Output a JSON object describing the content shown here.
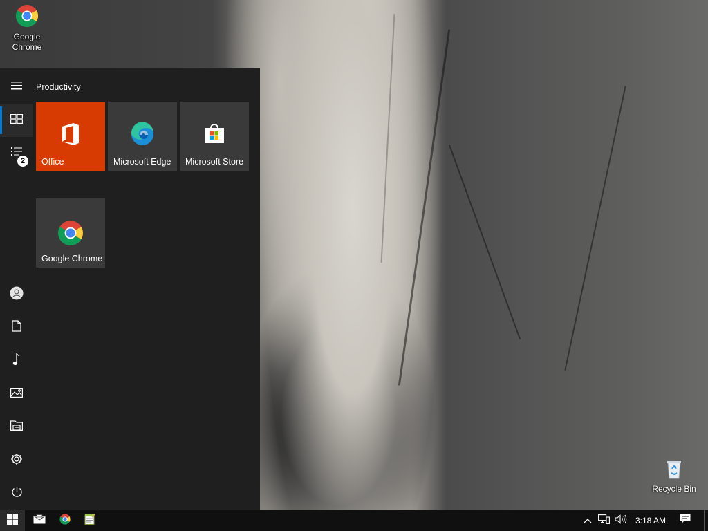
{
  "desktop": {
    "icons": [
      {
        "label_line1": "Google",
        "label_line2": "Chrome",
        "icon": "chrome-icon"
      },
      {
        "label_line1": "Recycle Bin",
        "icon": "recycle-bin-icon"
      }
    ]
  },
  "start_menu": {
    "group_title": "Productivity",
    "rail": {
      "menu_icon": "hamburger-icon",
      "tiles_icon": "tiles-icon",
      "all_apps_icon": "all-apps-list-icon",
      "all_apps_badge": "2",
      "bottom_icons": [
        "user-icon",
        "documents-icon",
        "music-icon",
        "pictures-icon",
        "file-explorer-icon",
        "settings-icon",
        "power-icon"
      ]
    },
    "tiles": [
      {
        "label": "Office",
        "icon": "office-icon",
        "color": "#d83b01"
      },
      {
        "label": "Microsoft Edge",
        "icon": "edge-icon",
        "color": "#3a3a3a"
      },
      {
        "label": "Microsoft Store",
        "icon": "store-icon",
        "color": "#3a3a3a"
      },
      {
        "label": "Google Chrome",
        "icon": "chrome-icon",
        "color": "#3a3a3a"
      }
    ]
  },
  "taskbar": {
    "start_icon": "windows-logo-icon",
    "pinned": [
      "mail-icon",
      "chrome-icon",
      "notepad-icon"
    ],
    "tray": {
      "chevron_icon": "chevron-up-icon",
      "network_icon": "network-icon",
      "volume_icon": "volume-icon",
      "clock": "3:18 AM",
      "notifications_icon": "action-center-icon"
    }
  },
  "colors": {
    "start_bg": "#1f1f1f",
    "tile_bg": "#3a3a3a",
    "accent": "#0078d7",
    "office_tile": "#d83b01",
    "taskbar_bg": "#101010"
  }
}
